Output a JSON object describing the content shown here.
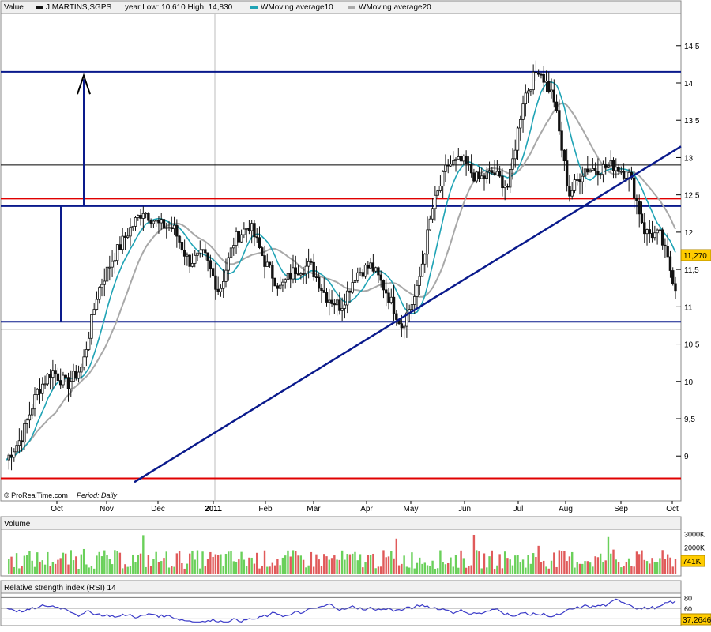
{
  "header": {
    "value_label": "Value",
    "symbol": "J.MARTINS,SGPS",
    "year_range": "year Low: 10,610  High: 14,830",
    "ma10_label": "WMoving average10",
    "ma20_label": "WMoving average20"
  },
  "footer": {
    "copyright": "© ProRealTime.com",
    "period": "Period: Daily"
  },
  "colors": {
    "up": "#1a1a1a",
    "down": "#1a1a1a",
    "ma10": "#1fa3b5",
    "ma20": "#a8a8a8",
    "annot_blue": "#0a1a8c",
    "annot_red": "#e00000",
    "vol_up": "#6ad05a",
    "vol_down": "#e05a5a",
    "badge": "#ffcc00",
    "rsi": "#3a3ac8"
  },
  "chart_data": [
    {
      "type": "candlestick",
      "title": "J.MARTINS,SGPS",
      "ylim": [
        8.6,
        14.9
      ],
      "y_ticks": [
        "9",
        "9,5",
        "10",
        "10,5",
        "11",
        "11,5",
        "12",
        "12,5",
        "13",
        "13,5",
        "14",
        "14,5"
      ],
      "y_tick_values": [
        9,
        9.5,
        10,
        10.5,
        11,
        11.5,
        12,
        12.5,
        13,
        13.5,
        14,
        14.5
      ],
      "x_labels": [
        "Oct",
        "Nov",
        "Dec",
        "2011",
        "Feb",
        "Mar",
        "Apr",
        "May",
        "Jun",
        "Jul",
        "Aug",
        "Sep",
        "Oct"
      ],
      "last_price": "11,270",
      "close": [
        8.95,
        9.25,
        9.85,
        10.15,
        9.95,
        10.2,
        11.2,
        11.65,
        12.0,
        12.3,
        12.1,
        12.05,
        11.6,
        11.7,
        11.2,
        11.9,
        12.1,
        11.6,
        11.25,
        11.5,
        11.55,
        11.15,
        11.0,
        11.45,
        11.55,
        11.2,
        10.75,
        11.2,
        12.3,
        12.9,
        12.95,
        12.7,
        12.8,
        12.6,
        13.8,
        14.2,
        13.8,
        12.5,
        12.85,
        12.85,
        12.9,
        12.75,
        12.0,
        11.95,
        11.27
      ],
      "resistance_lines": [
        14.15,
        12.9,
        12.45,
        12.35,
        10.8,
        10.7
      ],
      "support_line": 8.7
    },
    {
      "type": "bar",
      "title": "Volume",
      "y_ticks": [
        "1000K",
        "2000K",
        "3000K"
      ],
      "last_value": "741K"
    },
    {
      "type": "line",
      "title": "Relative strength index (RSI) 14",
      "y_ticks": [
        "40",
        "60",
        "80"
      ],
      "last_value": "37,2646"
    }
  ]
}
